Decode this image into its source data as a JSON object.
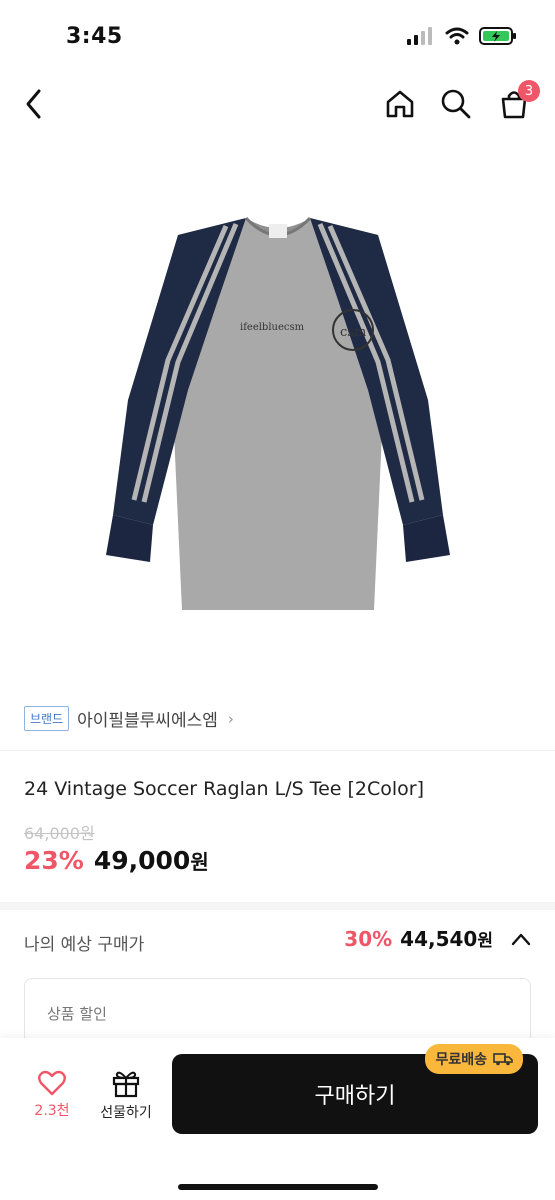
{
  "status": {
    "time": "3:45"
  },
  "nav": {
    "back_icon": "chevron-left-icon",
    "home_icon": "home-icon",
    "search_icon": "search-icon",
    "cart_icon": "shopping-bag-icon",
    "cart_count": "3"
  },
  "product": {
    "image_chest_text": "ifeelbluecsm",
    "image_logo_text": "csm",
    "brand_tag": "브랜드",
    "brand_name": "아이필블루씨에스엠",
    "title": "24 Vintage Soccer Raglan L/S Tee [2Color]",
    "original_price": "64,000원",
    "discount_rate": "23%",
    "sale_price": "49,000",
    "sale_unit": "원"
  },
  "expected": {
    "label": "나의 예상 구매가",
    "rate": "30%",
    "price": "44,540",
    "unit": "원"
  },
  "discount_box": {
    "label": "상품 할인"
  },
  "bottom": {
    "like_count": "2.3천",
    "gift_label": "선물하기",
    "buy_label": "구매하기",
    "shipping_badge": "무료배송"
  },
  "colors": {
    "accent": "#ef5667",
    "badge": "#f9b73b",
    "navy": "#1f2a44",
    "heather_gray": "#a9a9a9"
  }
}
